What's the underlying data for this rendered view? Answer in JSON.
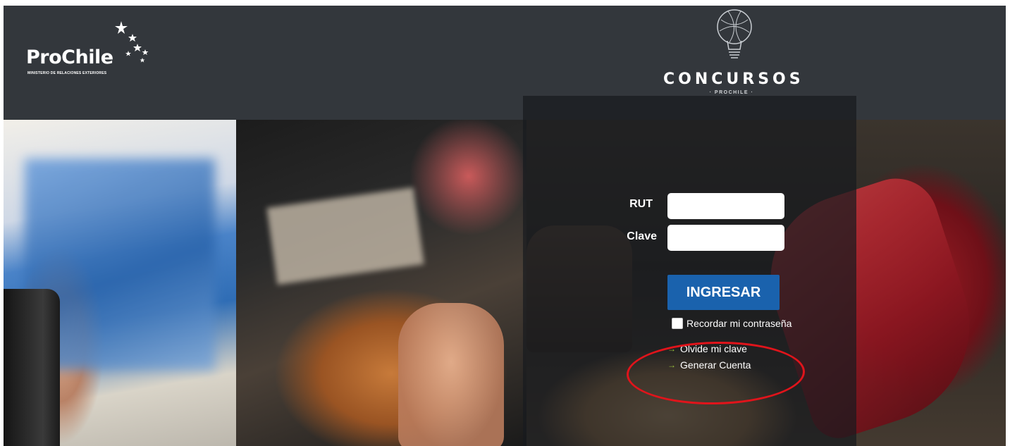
{
  "header": {
    "brand": "ProChile",
    "brand_subtitle": "MINISTERIO DE RELACIONES EXTERIORES",
    "contest_title": "CONCURSOS",
    "contest_subtitle": "· PROCHILE ·"
  },
  "login": {
    "rut_label": "RUT",
    "rut_value": "",
    "clave_label": "Clave",
    "clave_value": "",
    "submit_label": "INGRESAR",
    "remember_label": "Recordar mi contraseña",
    "remember_checked": false,
    "links": [
      {
        "label": "Olvide mi clave"
      },
      {
        "label": "Generar Cuenta"
      }
    ]
  },
  "colors": {
    "header_bg": "#33373c",
    "button_bg": "#1a62ad",
    "arrow": "#9bc83c",
    "annotation": "#e0141b"
  },
  "icons": [
    "star-icon",
    "lightbulb-icon",
    "arrow-right-icon"
  ]
}
